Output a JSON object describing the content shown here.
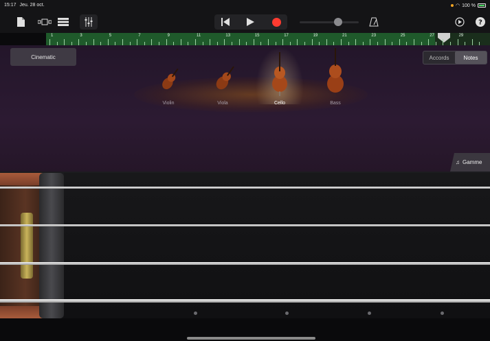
{
  "status": {
    "time": "15:17",
    "date": "Jeu. 28 oct.",
    "battery": "100 %"
  },
  "toolbar": {
    "icons": [
      "document-icon",
      "tracks-view-icon",
      "list-view-icon",
      "mixer-icon",
      "rewind-icon",
      "play-icon",
      "record-icon",
      "metronome-icon",
      "settings-icon",
      "help-icon"
    ]
  },
  "ruler": {
    "bars": [
      "1",
      "3",
      "5",
      "7",
      "9",
      "11",
      "13",
      "15",
      "17",
      "19",
      "21",
      "23",
      "25",
      "27",
      "29"
    ]
  },
  "track": {
    "preset_label": "Cinematic",
    "view_toggle": [
      "Accords",
      "Notes"
    ],
    "selected_view": "Notes",
    "instruments": [
      {
        "label": "Violin",
        "selected": false
      },
      {
        "label": "Viola",
        "selected": false
      },
      {
        "label": "Cello",
        "selected": true
      },
      {
        "label": "Bass",
        "selected": false
      }
    ],
    "scale_tab_label": "Gamme"
  },
  "colors": {
    "record": "#ff3b30",
    "accent_green": "#1f5a2b",
    "background": "#0a0a0c"
  }
}
